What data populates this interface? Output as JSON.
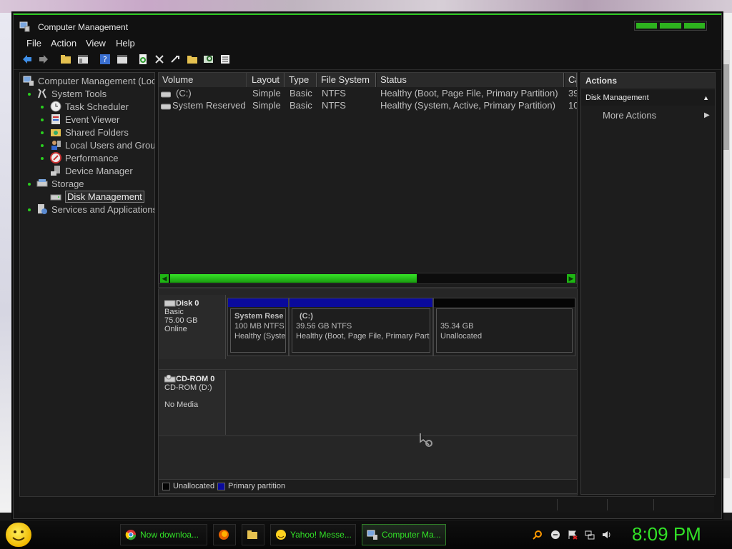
{
  "window": {
    "title": "Computer Management"
  },
  "menu": [
    "File",
    "Action",
    "View",
    "Help"
  ],
  "toolbar_icons": [
    "back-icon",
    "forward-icon",
    "up-folder-icon",
    "show-hide-tree-icon",
    "help-icon",
    "properties-icon",
    "refresh-icon",
    "delete-icon",
    "connect-icon",
    "open-icon",
    "search-icon",
    "settings-icon"
  ],
  "tree": {
    "root": "Computer Management (Loc",
    "system_tools": "System Tools",
    "task_scheduler": "Task Scheduler",
    "event_viewer": "Event Viewer",
    "shared_folders": "Shared Folders",
    "local_users": "Local Users and Grou",
    "performance": "Performance",
    "device_manager": "Device Manager",
    "storage": "Storage",
    "disk_management": "Disk Management",
    "services": "Services and Applications"
  },
  "volume_list": {
    "columns": [
      "Volume",
      "Layout",
      "Type",
      "File System",
      "Status",
      "Ca"
    ],
    "rows": [
      {
        "volume": "(C:)",
        "layout": "Simple",
        "type": "Basic",
        "fs": "NTFS",
        "status": "Healthy (Boot, Page File, Primary Partition)",
        "cap": "39"
      },
      {
        "volume": "System Reserved",
        "layout": "Simple",
        "type": "Basic",
        "fs": "NTFS",
        "status": "Healthy (System, Active, Primary Partition)",
        "cap": "10"
      }
    ]
  },
  "disks": {
    "disk0": {
      "name": "Disk 0",
      "type": "Basic",
      "size": "75.00 GB",
      "state": "Online",
      "partitions": [
        {
          "name": "System Rese",
          "size": "100 MB NTFS",
          "status": "Healthy (Syste"
        },
        {
          "name": "(C:)",
          "size": "39.56 GB NTFS",
          "status": "Healthy (Boot, Page File, Primary Partiti"
        },
        {
          "name": "",
          "size": "35.34 GB",
          "status": "Unallocated"
        }
      ]
    },
    "cdrom0": {
      "name": "CD-ROM 0",
      "type": "CD-ROM (D:)",
      "state": "No Media"
    }
  },
  "legend": {
    "unallocated": "Unallocated",
    "primary": "Primary partition"
  },
  "actions": {
    "header": "Actions",
    "section": "Disk Management",
    "more": "More Actions"
  },
  "taskbar": {
    "items": [
      "Now downloa...",
      "Yahoo! Messe...",
      "Computer Ma..."
    ],
    "clock": "8:09 PM"
  },
  "colors": {
    "accent_green": "#32e027",
    "primary_partition": "#0a0a9c",
    "unallocated": "#050505"
  }
}
